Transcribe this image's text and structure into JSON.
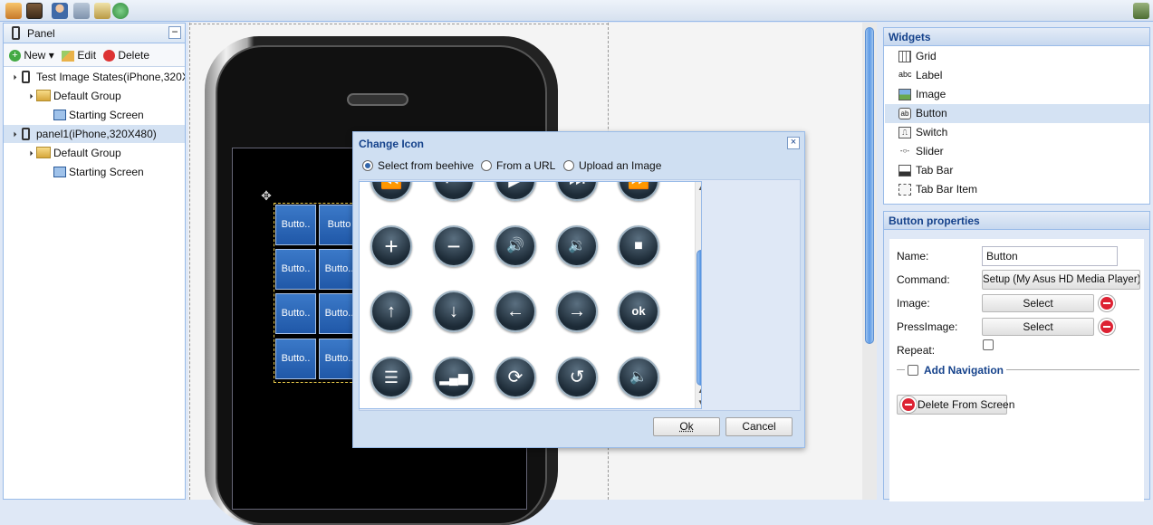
{
  "left_panel": {
    "title": "Panel",
    "toolbar": {
      "new": "New",
      "edit": "Edit",
      "delete": "Delete"
    },
    "tree": [
      {
        "label": "Test Image States(iPhone,320X480)"
      },
      {
        "label": "Default Group"
      },
      {
        "label": "Starting Screen"
      },
      {
        "label": "panel1(iPhone,320X480)"
      },
      {
        "label": "Default Group"
      },
      {
        "label": "Starting Screen"
      }
    ]
  },
  "phone": {
    "buttons": [
      "Butto..",
      "Butto",
      "Butto..",
      "Butto..",
      "Butto..",
      "Butto..",
      "Butto..",
      "Butto.."
    ]
  },
  "dialog": {
    "title": "Change Icon",
    "close": "×",
    "options": [
      "Select from beehive",
      "From a URL",
      "Upload an Image"
    ],
    "selected_option": "Select from beehive",
    "icons": [
      "rewind-icon",
      "skip-back-icon",
      "play-icon",
      "skip-forward-icon",
      "fast-forward-icon",
      "plus-icon",
      "minus-icon",
      "volume-up-icon",
      "volume-down-icon",
      "stop-icon",
      "arrow-up-icon",
      "arrow-down-icon",
      "arrow-left-icon",
      "arrow-right-icon",
      "ok-icon",
      "list-icon",
      "equalizer-icon",
      "refresh-icon",
      "undo-icon",
      "mute-icon"
    ],
    "ok": "Ok",
    "cancel": "Cancel"
  },
  "widgets": {
    "title": "Widgets",
    "items": [
      {
        "label": "Grid",
        "icon": "grid-icon"
      },
      {
        "label": "Label",
        "icon": "label-icon"
      },
      {
        "label": "Image",
        "icon": "image-icon"
      },
      {
        "label": "Button",
        "icon": "button-icon"
      },
      {
        "label": "Switch",
        "icon": "switch-icon"
      },
      {
        "label": "Slider",
        "icon": "slider-icon"
      },
      {
        "label": "Tab Bar",
        "icon": "tab-bar-icon"
      },
      {
        "label": "Tab Bar Item",
        "icon": "tab-bar-item-icon"
      }
    ],
    "selected": "Button"
  },
  "properties": {
    "title": "Button properties",
    "name_label": "Name:",
    "name_value": "Button",
    "command_label": "Command:",
    "command_value": "Setup (My Asus HD Media Player)",
    "image_label": "Image:",
    "image_button": "Select",
    "press_image_label": "PressImage:",
    "press_image_button": "Select",
    "repeat_label": "Repeat:",
    "add_navigation": "Add Navigation",
    "delete_from_screen": "Delete From Screen"
  },
  "colors": {
    "accent": "#15428b",
    "border": "#99bbe8",
    "phone_button": "#2a65b5"
  }
}
